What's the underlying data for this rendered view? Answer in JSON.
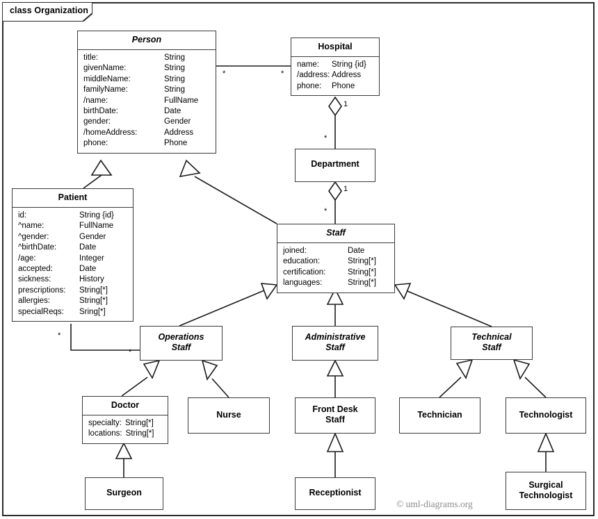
{
  "frame": {
    "label": "class Organization",
    "watermark": "© uml-diagrams.org"
  },
  "classes": {
    "person": {
      "name": "Person",
      "abstract": true,
      "attributes": [
        {
          "name": "title:",
          "type": "String"
        },
        {
          "name": "givenName:",
          "type": "String"
        },
        {
          "name": "middleName:",
          "type": "String"
        },
        {
          "name": "familyName:",
          "type": "String"
        },
        {
          "name": "/name:",
          "type": "FullName"
        },
        {
          "name": "birthDate:",
          "type": "Date"
        },
        {
          "name": "gender:",
          "type": "Gender"
        },
        {
          "name": "/homeAddress:",
          "type": "Address"
        },
        {
          "name": "phone:",
          "type": "Phone"
        }
      ]
    },
    "hospital": {
      "name": "Hospital",
      "abstract": false,
      "attributes": [
        {
          "name": "name:",
          "type": "String {id}"
        },
        {
          "name": "/address:",
          "type": "Address"
        },
        {
          "name": "phone:",
          "type": "Phone"
        }
      ]
    },
    "department": {
      "name": "Department",
      "abstract": false,
      "attributes": []
    },
    "patient": {
      "name": "Patient",
      "abstract": false,
      "attributes": [
        {
          "name": "id:",
          "type": "String {id}"
        },
        {
          "name": "^name:",
          "type": "FullName"
        },
        {
          "name": "^gender:",
          "type": "Gender"
        },
        {
          "name": "^birthDate:",
          "type": "Date"
        },
        {
          "name": "/age:",
          "type": "Integer"
        },
        {
          "name": "accepted:",
          "type": "Date"
        },
        {
          "name": "sickness:",
          "type": "History"
        },
        {
          "name": "prescriptions:",
          "type": "String[*]"
        },
        {
          "name": "allergies:",
          "type": "String[*]"
        },
        {
          "name": "specialReqs:",
          "type": "Sring[*]"
        }
      ]
    },
    "staff": {
      "name": "Staff",
      "abstract": true,
      "attributes": [
        {
          "name": "joined:",
          "type": "Date"
        },
        {
          "name": "education:",
          "type": "String[*]"
        },
        {
          "name": "certification:",
          "type": "String[*]"
        },
        {
          "name": "languages:",
          "type": "String[*]"
        }
      ]
    },
    "operations_staff": {
      "name": "Operations\nStaff",
      "abstract": true,
      "attributes": []
    },
    "administrative_staff": {
      "name": "Administrative\nStaff",
      "abstract": true,
      "attributes": []
    },
    "technical_staff": {
      "name": "Technical\nStaff",
      "abstract": true,
      "attributes": []
    },
    "doctor": {
      "name": "Doctor",
      "abstract": false,
      "attributes": [
        {
          "name": "specialty:",
          "type": "String[*]"
        },
        {
          "name": "locations:",
          "type": "String[*]"
        }
      ]
    },
    "nurse": {
      "name": "Nurse",
      "abstract": false,
      "attributes": []
    },
    "front_desk_staff": {
      "name": "Front Desk\nStaff",
      "abstract": false,
      "attributes": []
    },
    "technician": {
      "name": "Technician",
      "abstract": false,
      "attributes": []
    },
    "technologist": {
      "name": "Technologist",
      "abstract": false,
      "attributes": []
    },
    "surgeon": {
      "name": "Surgeon",
      "abstract": false,
      "attributes": []
    },
    "receptionist": {
      "name": "Receptionist",
      "abstract": false,
      "attributes": []
    },
    "surgical_technologist": {
      "name": "Surgical\nTechnologist",
      "abstract": false,
      "attributes": []
    }
  },
  "multiplicities": {
    "person_hospital_person_end": "*",
    "person_hospital_hospital_end": "*",
    "hospital_department_hospital_end": "1",
    "hospital_department_department_end": "*",
    "department_staff_department_end": "1",
    "department_staff_staff_end": "*",
    "patient_operations_patient_end": "*",
    "patient_operations_staff_end": "*"
  },
  "relationships": [
    {
      "kind": "association",
      "from": "Person",
      "to": "Hospital"
    },
    {
      "kind": "aggregation",
      "from": "Hospital",
      "to": "Department"
    },
    {
      "kind": "aggregation",
      "from": "Department",
      "to": "Staff"
    },
    {
      "kind": "association",
      "from": "Patient",
      "to": "Operations Staff"
    },
    {
      "kind": "generalization",
      "from": "Patient",
      "to": "Person"
    },
    {
      "kind": "generalization",
      "from": "Staff",
      "to": "Person"
    },
    {
      "kind": "generalization",
      "from": "Operations Staff",
      "to": "Staff"
    },
    {
      "kind": "generalization",
      "from": "Administrative Staff",
      "to": "Staff"
    },
    {
      "kind": "generalization",
      "from": "Technical Staff",
      "to": "Staff"
    },
    {
      "kind": "generalization",
      "from": "Doctor",
      "to": "Operations Staff"
    },
    {
      "kind": "generalization",
      "from": "Nurse",
      "to": "Operations Staff"
    },
    {
      "kind": "generalization",
      "from": "Front Desk Staff",
      "to": "Administrative Staff"
    },
    {
      "kind": "generalization",
      "from": "Technician",
      "to": "Technical Staff"
    },
    {
      "kind": "generalization",
      "from": "Technologist",
      "to": "Technical Staff"
    },
    {
      "kind": "generalization",
      "from": "Surgeon",
      "to": "Doctor"
    },
    {
      "kind": "generalization",
      "from": "Receptionist",
      "to": "Front Desk Staff"
    },
    {
      "kind": "generalization",
      "from": "Surgical Technologist",
      "to": "Technologist"
    }
  ],
  "colors": {
    "stroke": "#1a1a1a",
    "box_border": "#3a3a3a",
    "background": "#ffffff",
    "watermark": "#8d8d8d"
  }
}
